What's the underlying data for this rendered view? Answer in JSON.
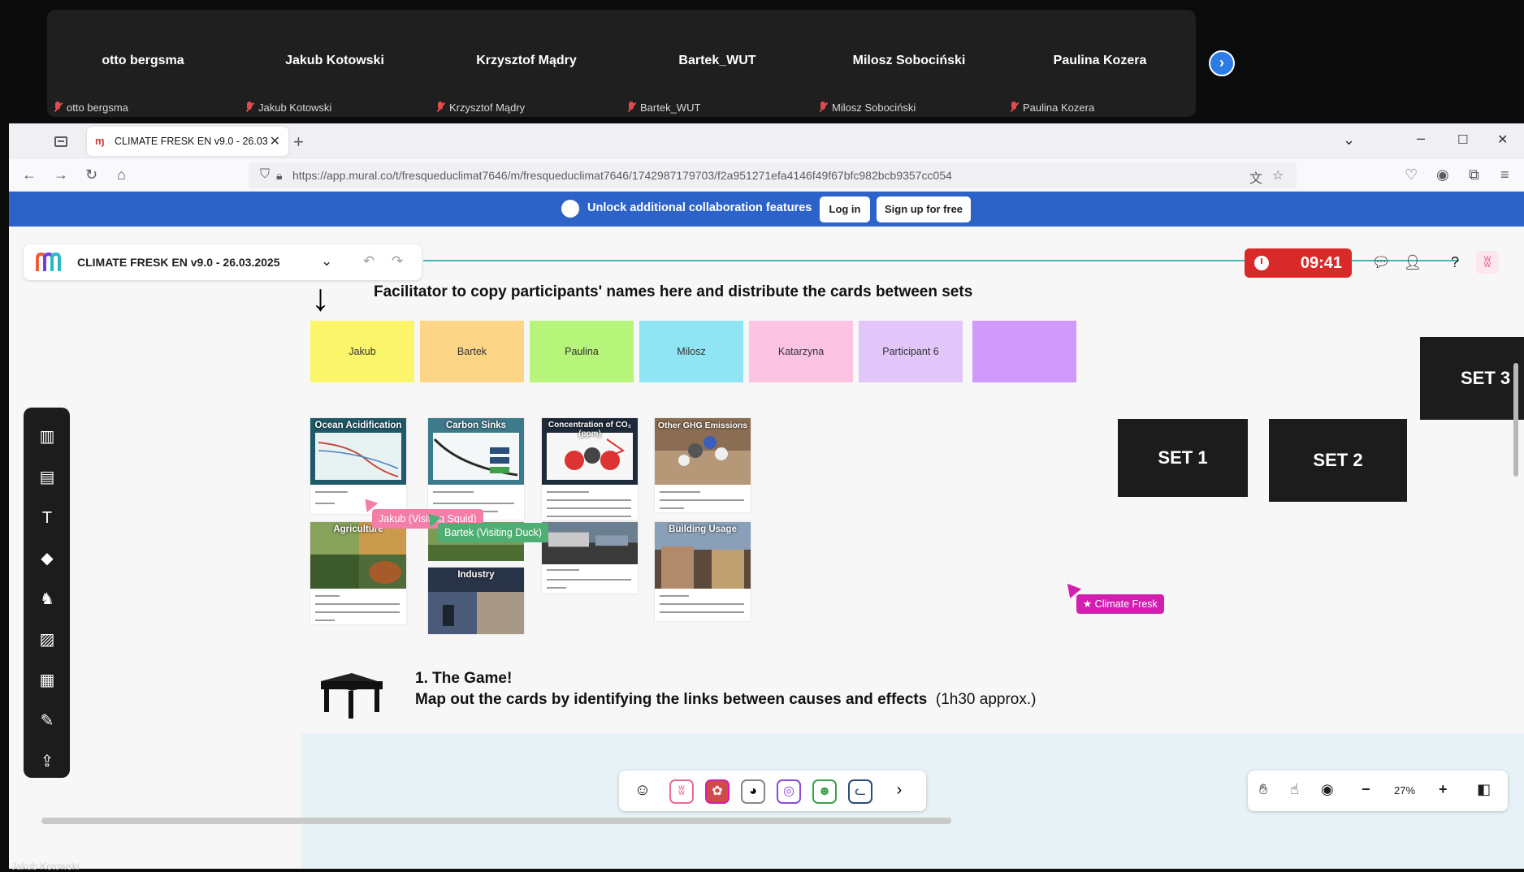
{
  "call": {
    "participants": [
      {
        "name": "otto bergsma",
        "sub": "otto bergsma"
      },
      {
        "name": "Jakub Kotowski",
        "sub": "Jakub Kotowski"
      },
      {
        "name": "Krzysztof Mądry",
        "sub": "Krzysztof Mądry"
      },
      {
        "name": "Bartek_WUT",
        "sub": "Bartek_WUT"
      },
      {
        "name": "Milosz Sobociński",
        "sub": "Milosz Sobociński"
      },
      {
        "name": "Paulina Kozera",
        "sub": "Paulina Kozera"
      }
    ],
    "next_icon": "chevron-right-icon",
    "bottom_name": "Jakub Kotowski"
  },
  "browser": {
    "tab_title": "CLIMATE FRESK EN v9.0 - 26.03",
    "url": "https://app.mural.co/t/fresqueduclimat7646/m/fresqueduclimat7646/1742987179703/f2a951271efa4146f49f67bfc982bcb9357cc054"
  },
  "banner": {
    "text": "Unlock additional collaboration features",
    "login": "Log in",
    "signup": "Sign up for free",
    "color": "#2d63c8"
  },
  "mural": {
    "title": "CLIMATE FRESK EN v9.0 - 26.03.2025",
    "timer": "09:41",
    "timer_color": "#d92929",
    "zoom": "27%"
  },
  "canvas": {
    "instruction": "Facilitator to copy participants' names here and distribute the cards between sets",
    "stickies": [
      {
        "label": "Jakub",
        "color": "#fbf56b"
      },
      {
        "label": "Bartek",
        "color": "#fcd686"
      },
      {
        "label": "Paulina",
        "color": "#b6f47a"
      },
      {
        "label": "Milosz",
        "color": "#90e5f4"
      },
      {
        "label": "Katarzyna",
        "color": "#fdc3e3"
      },
      {
        "label": "Participant 6",
        "color": "#e2c5f9"
      },
      {
        "label": "",
        "color": "#cf9af9"
      }
    ],
    "cards": [
      {
        "title": "Ocean Acidification"
      },
      {
        "title": "Carbon Sinks"
      },
      {
        "title": "Concentration of CO₂ (ppm)"
      },
      {
        "title": "Other GHG Emissions"
      },
      {
        "title": "Agriculture"
      },
      {
        "title": "Industry"
      },
      {
        "title": "Building Usage"
      }
    ],
    "sets": [
      "SET 1",
      "SET 2",
      "SET 3"
    ],
    "cursors": [
      {
        "label": "Jakub (Visiting Squid)",
        "color": "#f37ea8"
      },
      {
        "label": "Bartek (Visiting Duck)",
        "color": "#4fae73"
      },
      {
        "label": "★ Climate Fresk",
        "color": "#d21fb0"
      }
    ],
    "game_title": "1. The Game!",
    "game_desc_bold": "Map out the cards by identifying the links between causes and effects",
    "game_desc_time": "(1h30 approx.)"
  }
}
